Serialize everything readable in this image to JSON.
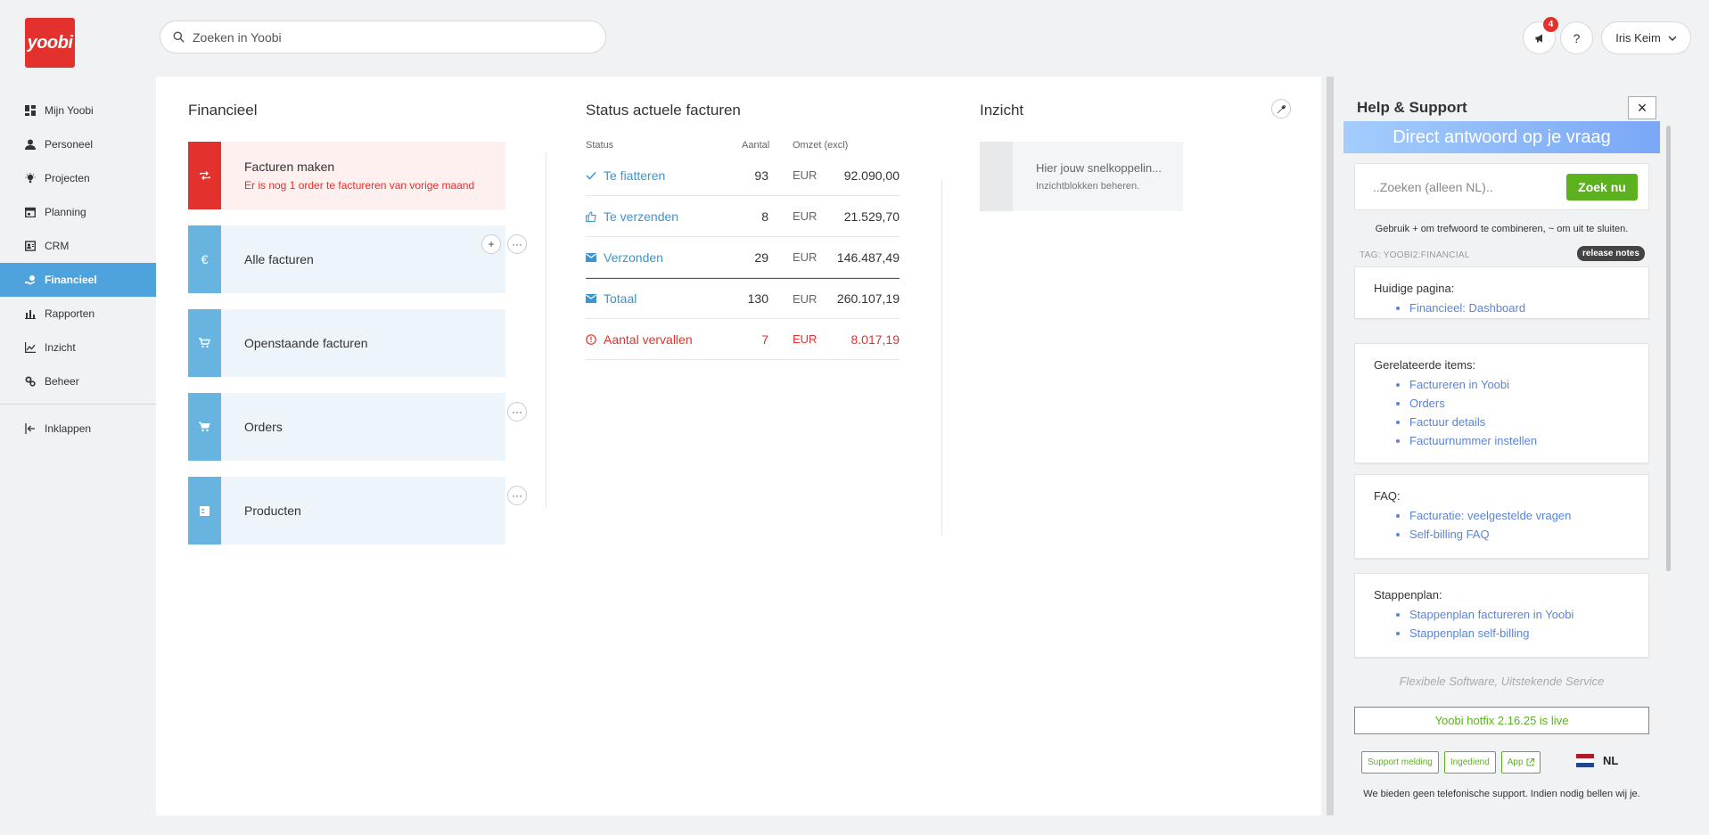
{
  "logo": {
    "text": "yoobi"
  },
  "search": {
    "placeholder": "Zoeken in Yoobi"
  },
  "topbar": {
    "notifications_count": "4",
    "help_label": "?",
    "user_name": "Iris Keim"
  },
  "nav": {
    "items": [
      {
        "label": "Mijn Yoobi",
        "icon": "dashboard-icon"
      },
      {
        "label": "Personeel",
        "icon": "person-icon"
      },
      {
        "label": "Projecten",
        "icon": "lightbulb-icon"
      },
      {
        "label": "Planning",
        "icon": "calendar-icon"
      },
      {
        "label": "CRM",
        "icon": "contacts-icon"
      },
      {
        "label": "Financieel",
        "icon": "money-icon",
        "active": true
      },
      {
        "label": "Rapporten",
        "icon": "bar-chart-icon"
      },
      {
        "label": "Inzicht",
        "icon": "line-chart-icon"
      },
      {
        "label": "Beheer",
        "icon": "gears-icon"
      }
    ],
    "collapse_label": "Inklappen"
  },
  "financieel": {
    "title": "Financieel",
    "tiles": [
      {
        "label": "Facturen maken",
        "sub": "Er is nog 1 order te factureren van vorige maand"
      },
      {
        "label": "Alle facturen"
      },
      {
        "label": "Openstaande facturen"
      },
      {
        "label": "Orders"
      },
      {
        "label": "Producten"
      }
    ]
  },
  "status": {
    "title": "Status actuele facturen",
    "headers": {
      "status": "Status",
      "aantal": "Aantal",
      "omzet": "Omzet (excl)"
    },
    "rows": [
      {
        "label": "Te fiatteren",
        "count": "93",
        "currency": "EUR",
        "amount": "92.090,00"
      },
      {
        "label": "Te verzenden",
        "count": "8",
        "currency": "EUR",
        "amount": "21.529,70"
      },
      {
        "label": "Verzonden",
        "count": "29",
        "currency": "EUR",
        "amount": "146.487,49"
      },
      {
        "label": "Totaal",
        "count": "130",
        "currency": "EUR",
        "amount": "260.107,19"
      },
      {
        "label": "Aantal vervallen",
        "count": "7",
        "currency": "EUR",
        "amount": "8.017,19"
      }
    ]
  },
  "inzicht": {
    "title": "Inzicht",
    "tile_label": "Hier jouw snelkoppelin...",
    "tile_sub": "Inzichtblokken beheren."
  },
  "help": {
    "title": "Help & Support",
    "close": "×",
    "hero": "Direct antwoord op je vraag",
    "search_placeholder": "..Zoeken (alleen NL)..",
    "search_button": "Zoek nu",
    "hint": "Gebruik + om trefwoord te combineren, ~ om uit te sluiten.",
    "tag": "TAG: YOOBI2:FINANCIAL",
    "release_notes": "release notes",
    "cards": [
      {
        "title": "Huidige pagina:",
        "links": [
          "Financieel: Dashboard"
        ]
      },
      {
        "title": "Gerelateerde items:",
        "links": [
          "Factureren in Yoobi",
          "Orders",
          "Factuur details",
          "Factuurnummer instellen"
        ]
      },
      {
        "title": "FAQ:",
        "links": [
          "Facturatie: veelgestelde vragen",
          "Self-billing FAQ"
        ]
      },
      {
        "title": "Stappenplan:",
        "links": [
          "Stappenplan factureren in Yoobi",
          "Stappenplan self-billing"
        ]
      }
    ],
    "slogan": "Flexibele Software, Uitstekende Service",
    "hotfix": "Yoobi hotfix 2.16.25 is live",
    "buttons": [
      "Support melding",
      "Ingediend",
      "App"
    ],
    "language": "NL",
    "phone_note": "We bieden geen telefonische support. Indien nodig bellen wij je."
  },
  "colors": {
    "red": "#e3312d",
    "blue": "#4fa3dc",
    "green": "#5cb11e",
    "link": "#5b84d6"
  }
}
